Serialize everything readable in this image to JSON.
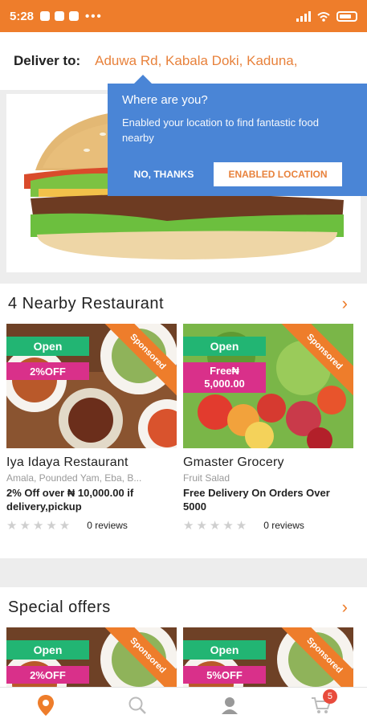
{
  "status_bar": {
    "time": "5:28",
    "more": "•••"
  },
  "header": {
    "deliver_label": "Deliver to:",
    "address": "Aduwa Rd, Kabala Doki, Kaduna,"
  },
  "location_popup": {
    "title": "Where are you?",
    "message": "Enabled your location to find fantastic food nearby",
    "no_thanks": "NO, THANKS",
    "enable": "ENABLED LOCATION"
  },
  "nearby": {
    "title": "4 Nearby Restaurant",
    "chevron": "›",
    "cards": [
      {
        "open": "Open",
        "offer": "2%OFF",
        "sponsored": "Sponsored",
        "name": "Iya Idaya Restaurant",
        "category": "Amala, Pounded Yam, Eba, B...",
        "deal": "2% Off over ₦ 10,000.00 if delivery,pickup",
        "reviews": "0 reviews"
      },
      {
        "open": "Open",
        "offer_line1": "Free₦",
        "offer_line2": "5,000.00",
        "sponsored": "Sponsored",
        "name": "Gmaster Grocery",
        "category": "Fruit Salad",
        "deal": "Free Delivery On Orders Over 5000",
        "reviews": "0 reviews"
      }
    ]
  },
  "special": {
    "title": "Special offers",
    "chevron": "›",
    "cards": [
      {
        "open": "Open",
        "offer": "2%OFF",
        "sponsored": "Sponsored"
      },
      {
        "open": "Open",
        "offer": "5%OFF",
        "sponsored": "Sponsored"
      }
    ]
  },
  "bottom_nav": {
    "cart_count": "5",
    "icons": [
      "location-icon",
      "search-icon",
      "profile-icon",
      "cart-icon"
    ]
  },
  "colors": {
    "accent": "#ee7d2b",
    "open_green": "#22b573",
    "offer_pink": "#d9308a",
    "popup_blue": "#4a85d6"
  }
}
